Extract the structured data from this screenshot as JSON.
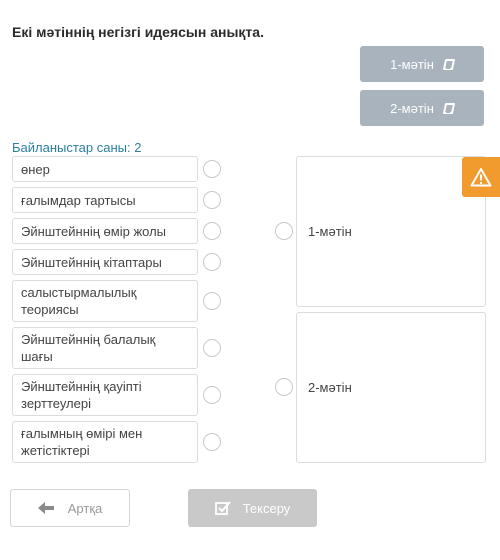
{
  "header": {
    "title": "Екі мәтіннің негізгі идеясын анықта."
  },
  "text_buttons": [
    {
      "label": "1-мәтін",
      "icon": "book-icon"
    },
    {
      "label": "2-мәтін",
      "icon": "book-icon"
    }
  ],
  "links_count": "Байланыстар саны: 2",
  "items": [
    {
      "label": "өнер"
    },
    {
      "label": "ғалымдар тартысы"
    },
    {
      "label": "Эйнштейннің өмір жолы"
    },
    {
      "label": "Эйнштейннің кітаптары"
    },
    {
      "label": "салыстырмалылық теориясы"
    },
    {
      "label": "Эйнштейннің балалық шағы"
    },
    {
      "label": "Эйнштейннің қауіпті зерттеулері"
    },
    {
      "label": "ғалымның өмірі мен жетістіктері"
    }
  ],
  "targets": [
    {
      "label": "1-мәтін"
    },
    {
      "label": "2-мәтін"
    }
  ],
  "footer": {
    "back_label": "Артқа",
    "check_label": "Тексеру"
  },
  "colors": {
    "accent_link": "#2a7f9e",
    "warning": "#f19a2e",
    "button_disabled": "#c9c9c9",
    "text_button": "#a9b3bd"
  }
}
